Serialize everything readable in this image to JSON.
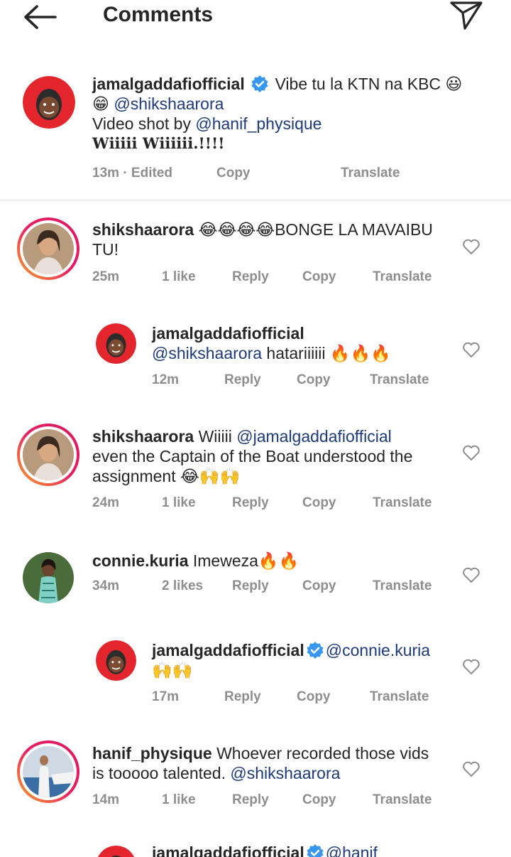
{
  "header": {
    "title": "Comments"
  },
  "caption": {
    "username": "jamalgaddafiofficial",
    "line1": "Vibe tu la KTN na KBC 😃",
    "line2_emoji": "😁",
    "line2_mention": "@shikshaarora",
    "line3_text": "Video shot by ",
    "line3_mention": "@hanif_physique",
    "line4": "𝐖𝐢𝐢𝐢𝐢𝐢 𝐖𝐢𝐢𝐢𝐢𝐢𝐢.!!!!",
    "time": "13m · Edited",
    "copy": "Copy",
    "translate": "Translate"
  },
  "comments": [
    {
      "username": "shikshaarora",
      "text_line1": "😂😂😂😂BONGE LA MAVAIBU",
      "text_line2": "TU!",
      "time": "25m",
      "likes": "1 like",
      "reply": "Reply",
      "copy": "Copy",
      "translate": "Translate"
    },
    {
      "username": "jamalgaddafiofficial",
      "mention": "@shikshaarora",
      "text": " hatariiiiii 🔥🔥🔥",
      "time": "12m",
      "reply": "Reply",
      "copy": "Copy",
      "translate": "Translate"
    },
    {
      "username": "shikshaarora",
      "text_pre": "Wiiiii ",
      "mention": "@jamalgaddafiofficial",
      "text_line2": "even the Captain of the Boat understood the",
      "text_line3": "assignment 😂🙌🙌",
      "time": "24m",
      "likes": "1 like",
      "reply": "Reply",
      "copy": "Copy",
      "translate": "Translate"
    },
    {
      "username": "connie.kuria",
      "text": "Imeweza🔥🔥",
      "time": "34m",
      "likes": "2 likes",
      "reply": "Reply",
      "copy": "Copy",
      "translate": "Translate"
    },
    {
      "username": "jamalgaddafiofficial",
      "mention": "@connie.kuria",
      "text_line2": "🙌🙌",
      "time": "17m",
      "reply": "Reply",
      "copy": "Copy",
      "translate": "Translate"
    },
    {
      "username": "hanif_physique",
      "text_line1": "Whoever recorded those vids",
      "text_line2_pre": "is tooooo talented. ",
      "mention": "@shikshaarora",
      "time": "14m",
      "likes": "1 like",
      "reply": "Reply",
      "copy": "Copy",
      "translate": "Translate"
    },
    {
      "username": "jamalgaddafiofficial",
      "mention": "@hanif_"
    }
  ],
  "colors": {
    "text": "#262626",
    "meta": "#8e8e8e",
    "mention": "#1e3a78",
    "verified": "#3897f0",
    "avatar_red": "#e3262d",
    "story_ring": "#e91e63"
  }
}
